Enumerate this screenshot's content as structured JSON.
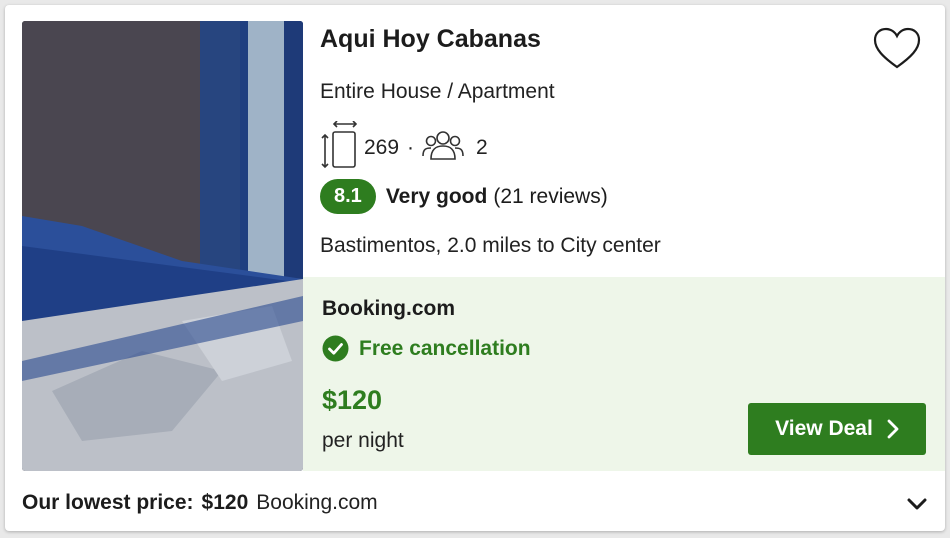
{
  "listing": {
    "title": "Aqui Hoy Cabanas",
    "type": "Entire House / Apartment",
    "size": "269",
    "guests": "2",
    "separator": "·",
    "rating": {
      "score": "8.1",
      "label": "Very good",
      "reviews": "(21 reviews)"
    },
    "location": "Bastimentos, 2.0 miles to City center"
  },
  "deal": {
    "provider": "Booking.com",
    "cancellation": "Free cancellation",
    "price": "$120",
    "price_unit": "per night",
    "button_label": "View Deal"
  },
  "footer": {
    "label": "Our lowest price:",
    "price": "$120",
    "provider": "Booking.com"
  },
  "colors": {
    "accent_green": "#2e7d1f",
    "deal_background": "#eef6e9"
  },
  "icons": [
    "heart-icon",
    "room-size-icon",
    "guests-icon",
    "check-circle-icon",
    "chevron-right-icon",
    "chevron-down-icon"
  ]
}
